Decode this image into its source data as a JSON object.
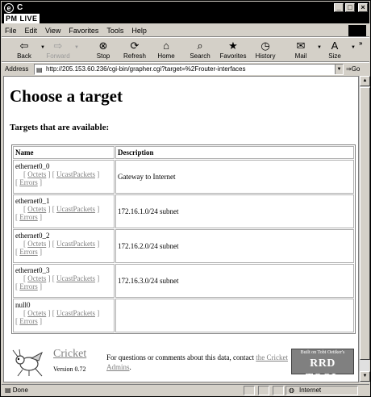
{
  "window": {
    "title": "C",
    "brand": "PM LIVE"
  },
  "menu": [
    "File",
    "Edit",
    "View",
    "Favorites",
    "Tools",
    "Help"
  ],
  "toolbar": [
    {
      "label": "Back",
      "icon": "back-arrow-icon",
      "glyph": "⇦",
      "enabled": true,
      "dropdown": true
    },
    {
      "label": "Forward",
      "icon": "forward-arrow-icon",
      "glyph": "⇨",
      "enabled": false,
      "dropdown": true
    },
    {
      "label": "Stop",
      "icon": "stop-icon",
      "glyph": "⊗",
      "enabled": true,
      "dropdown": false
    },
    {
      "label": "Refresh",
      "icon": "refresh-icon",
      "glyph": "⟳",
      "enabled": true,
      "dropdown": false
    },
    {
      "label": "Home",
      "icon": "home-icon",
      "glyph": "⌂",
      "enabled": true,
      "dropdown": false
    },
    {
      "label": "Search",
      "icon": "search-icon",
      "glyph": "⌕",
      "enabled": true,
      "dropdown": false
    },
    {
      "label": "Favorites",
      "icon": "favorites-icon",
      "glyph": "★",
      "enabled": true,
      "dropdown": false
    },
    {
      "label": "History",
      "icon": "history-icon",
      "glyph": "◷",
      "enabled": true,
      "dropdown": false
    },
    {
      "label": "Mail",
      "icon": "mail-icon",
      "glyph": "✉",
      "enabled": true,
      "dropdown": true
    },
    {
      "label": "Size",
      "icon": "text-size-icon",
      "glyph": "A",
      "enabled": true,
      "dropdown": true
    }
  ],
  "address": {
    "label": "Address",
    "url": "http://205.153.60.236/cgi-bin/grapher.cgi?target=%2Frouter-interfaces",
    "go": "Go"
  },
  "page": {
    "heading": "Choose a target",
    "subheading": "Targets that are available:",
    "columns": {
      "name": "Name",
      "description": "Description"
    },
    "rows": [
      {
        "name": "ethernet0_0",
        "description": "Gateway to Internet"
      },
      {
        "name": "ethernet0_1",
        "description": "172.16.1.0/24 subnet"
      },
      {
        "name": "ethernet0_2",
        "description": "172.16.2.0/24 subnet"
      },
      {
        "name": "ethernet0_3",
        "description": "172.16.3.0/24 subnet"
      },
      {
        "name": "null0",
        "description": ""
      }
    ],
    "links": {
      "open": "[",
      "close": "]",
      "octets": "Octets",
      "ucast": "UcastPackets",
      "errors": "Errors"
    },
    "footer": {
      "name": "Cricket",
      "version": "Version 0.72",
      "contact_text": "For questions or comments about this data, contact",
      "contact_link": "the Cricket Admins",
      "contact_end": ".",
      "badge_small": "Built on Tobi Oetiker's",
      "badge_big": "RRD TOOL"
    }
  },
  "status": {
    "text": "Done",
    "zone": "Internet"
  }
}
